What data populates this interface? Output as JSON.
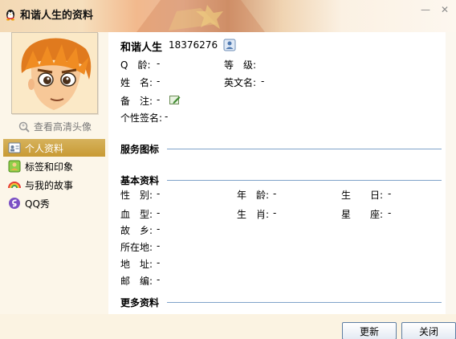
{
  "window": {
    "title": "和谐人生的资料",
    "minimize_glyph": "—",
    "close_glyph": "✕"
  },
  "sidebar": {
    "view_hd_avatar": "查看高清头像",
    "items": [
      {
        "label": "个人资料",
        "icon": "profile-card-icon",
        "selected": true
      },
      {
        "label": "标签和印象",
        "icon": "tag-person-icon",
        "selected": false
      },
      {
        "label": "与我的故事",
        "icon": "rainbow-icon",
        "selected": false
      },
      {
        "label": "QQ秀",
        "icon": "qq-show-icon",
        "selected": false
      }
    ]
  },
  "profile": {
    "nickname": "和谐人生",
    "qq_number": "18376276",
    "q_age_label": "Q　龄:",
    "q_age_value": "-",
    "level_label": "等　级:",
    "level_value": "",
    "name_label": "姓　名:",
    "name_value": "-",
    "english_name_label": "英文名:",
    "english_name_value": "-",
    "remark_label": "备　注:",
    "remark_value": "-",
    "signature_label": "个性签名:",
    "signature_value": "-"
  },
  "sections": {
    "service_icons": "服务图标",
    "basic_info": "基本资料",
    "more_info": "更多资料"
  },
  "basic": {
    "gender_label": "性　别:",
    "gender_value": "-",
    "age_label": "年　龄:",
    "age_value": "-",
    "birthday_label": "生　　日:",
    "birthday_value": "-",
    "blood_label": "血　型:",
    "blood_value": "-",
    "zodiac_label": "生　肖:",
    "zodiac_value": "-",
    "constellation_label": "星　　座:",
    "constellation_value": "-",
    "hometown_label": "故　乡:",
    "hometown_value": "-",
    "location_label": "所在地:",
    "location_value": "-",
    "address_label": "地　址:",
    "address_value": "-",
    "zip_label": "邮　编:",
    "zip_value": "-"
  },
  "buttons": {
    "refresh": "更新",
    "close": "关闭"
  }
}
